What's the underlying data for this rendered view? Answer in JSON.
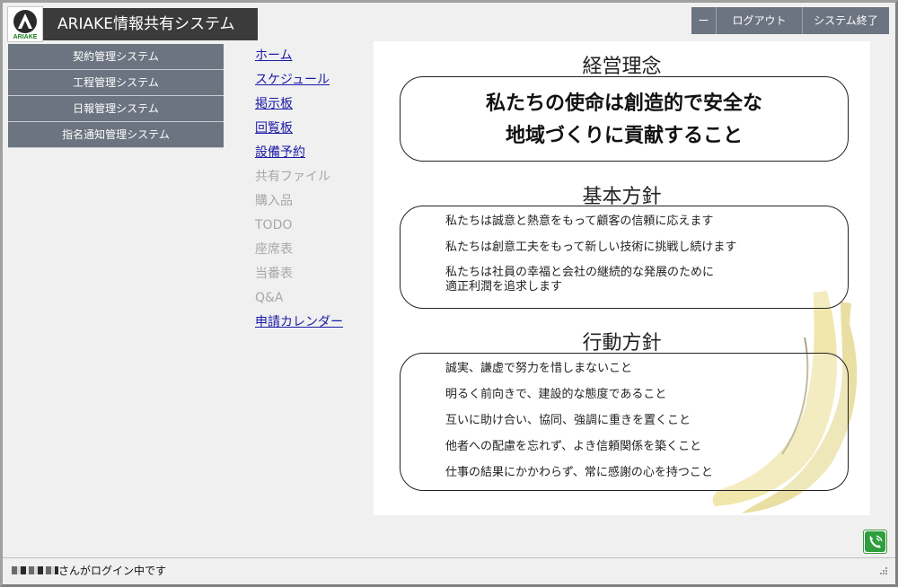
{
  "header": {
    "logo_text": "ARIAKE",
    "app_title": "ARIAKE情報共有システム",
    "buttons": {
      "minimize": "ー",
      "logout": "ログアウト",
      "exit": "システム終了"
    }
  },
  "system_menu": [
    "契約管理システム",
    "工程管理システム",
    "日報管理システム",
    "指名通知管理システム"
  ],
  "nav_links": [
    {
      "label": "ホーム",
      "enabled": true
    },
    {
      "label": "スケジュール",
      "enabled": true
    },
    {
      "label": "掲示板",
      "enabled": true
    },
    {
      "label": "回覧板",
      "enabled": true
    },
    {
      "label": "設備予約",
      "enabled": true
    },
    {
      "label": "共有ファイル",
      "enabled": false
    },
    {
      "label": "購入品",
      "enabled": false
    },
    {
      "label": "TODO",
      "enabled": false
    },
    {
      "label": "座席表",
      "enabled": false
    },
    {
      "label": "当番表",
      "enabled": false
    },
    {
      "label": "Q&A",
      "enabled": false
    },
    {
      "label": "申請カレンダー",
      "enabled": true
    }
  ],
  "content": {
    "philosophy": {
      "title": "経営理念",
      "lines": [
        "私たちの使命は創造的で安全な",
        "地域づくりに貢献すること"
      ]
    },
    "basic_policy": {
      "title": "基本方針",
      "lines": [
        "私たちは誠意と熱意をもって顧客の信頼に応えます",
        "私たちは創意工夫をもって新しい技術に挑戦し続けます",
        "私たちは社員の幸福と会社の継続的な発展のために",
        "適正利潤を追求します"
      ]
    },
    "action_policy": {
      "title": "行動方針",
      "lines": [
        "誠実、謙虚で努力を惜しまないこと",
        "明るく前向きで、建設的な態度であること",
        "互いに助け合い、協同、強調に重きを置くこと",
        "他者への配慮を忘れず、よき信頼関係を築くこと",
        "仕事の結果にかかわらず、常に感謝の心を持つこと"
      ]
    }
  },
  "status_bar": {
    "login_text": "さんがログイン中です"
  },
  "colors": {
    "menu_bg": "#6b7480",
    "title_bg": "#3b3b3b",
    "link": "#1a1aa8",
    "link_disabled": "#a8a8a8",
    "logo_green": "#1a7a1a"
  }
}
